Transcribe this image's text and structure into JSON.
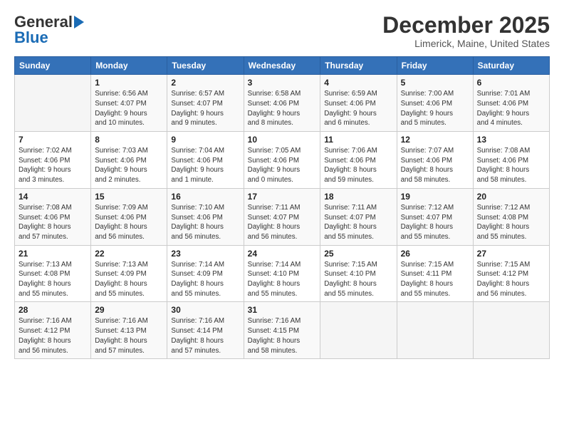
{
  "header": {
    "logo_general": "General",
    "logo_blue": "Blue",
    "month_title": "December 2025",
    "location": "Limerick, Maine, United States"
  },
  "weekdays": [
    "Sunday",
    "Monday",
    "Tuesday",
    "Wednesday",
    "Thursday",
    "Friday",
    "Saturday"
  ],
  "weeks": [
    [
      {
        "day": "",
        "info": ""
      },
      {
        "day": "1",
        "info": "Sunrise: 6:56 AM\nSunset: 4:07 PM\nDaylight: 9 hours\nand 10 minutes."
      },
      {
        "day": "2",
        "info": "Sunrise: 6:57 AM\nSunset: 4:07 PM\nDaylight: 9 hours\nand 9 minutes."
      },
      {
        "day": "3",
        "info": "Sunrise: 6:58 AM\nSunset: 4:06 PM\nDaylight: 9 hours\nand 8 minutes."
      },
      {
        "day": "4",
        "info": "Sunrise: 6:59 AM\nSunset: 4:06 PM\nDaylight: 9 hours\nand 6 minutes."
      },
      {
        "day": "5",
        "info": "Sunrise: 7:00 AM\nSunset: 4:06 PM\nDaylight: 9 hours\nand 5 minutes."
      },
      {
        "day": "6",
        "info": "Sunrise: 7:01 AM\nSunset: 4:06 PM\nDaylight: 9 hours\nand 4 minutes."
      }
    ],
    [
      {
        "day": "7",
        "info": "Sunrise: 7:02 AM\nSunset: 4:06 PM\nDaylight: 9 hours\nand 3 minutes."
      },
      {
        "day": "8",
        "info": "Sunrise: 7:03 AM\nSunset: 4:06 PM\nDaylight: 9 hours\nand 2 minutes."
      },
      {
        "day": "9",
        "info": "Sunrise: 7:04 AM\nSunset: 4:06 PM\nDaylight: 9 hours\nand 1 minute."
      },
      {
        "day": "10",
        "info": "Sunrise: 7:05 AM\nSunset: 4:06 PM\nDaylight: 9 hours\nand 0 minutes."
      },
      {
        "day": "11",
        "info": "Sunrise: 7:06 AM\nSunset: 4:06 PM\nDaylight: 8 hours\nand 59 minutes."
      },
      {
        "day": "12",
        "info": "Sunrise: 7:07 AM\nSunset: 4:06 PM\nDaylight: 8 hours\nand 58 minutes."
      },
      {
        "day": "13",
        "info": "Sunrise: 7:08 AM\nSunset: 4:06 PM\nDaylight: 8 hours\nand 58 minutes."
      }
    ],
    [
      {
        "day": "14",
        "info": "Sunrise: 7:08 AM\nSunset: 4:06 PM\nDaylight: 8 hours\nand 57 minutes."
      },
      {
        "day": "15",
        "info": "Sunrise: 7:09 AM\nSunset: 4:06 PM\nDaylight: 8 hours\nand 56 minutes."
      },
      {
        "day": "16",
        "info": "Sunrise: 7:10 AM\nSunset: 4:06 PM\nDaylight: 8 hours\nand 56 minutes."
      },
      {
        "day": "17",
        "info": "Sunrise: 7:11 AM\nSunset: 4:07 PM\nDaylight: 8 hours\nand 56 minutes."
      },
      {
        "day": "18",
        "info": "Sunrise: 7:11 AM\nSunset: 4:07 PM\nDaylight: 8 hours\nand 55 minutes."
      },
      {
        "day": "19",
        "info": "Sunrise: 7:12 AM\nSunset: 4:07 PM\nDaylight: 8 hours\nand 55 minutes."
      },
      {
        "day": "20",
        "info": "Sunrise: 7:12 AM\nSunset: 4:08 PM\nDaylight: 8 hours\nand 55 minutes."
      }
    ],
    [
      {
        "day": "21",
        "info": "Sunrise: 7:13 AM\nSunset: 4:08 PM\nDaylight: 8 hours\nand 55 minutes."
      },
      {
        "day": "22",
        "info": "Sunrise: 7:13 AM\nSunset: 4:09 PM\nDaylight: 8 hours\nand 55 minutes."
      },
      {
        "day": "23",
        "info": "Sunrise: 7:14 AM\nSunset: 4:09 PM\nDaylight: 8 hours\nand 55 minutes."
      },
      {
        "day": "24",
        "info": "Sunrise: 7:14 AM\nSunset: 4:10 PM\nDaylight: 8 hours\nand 55 minutes."
      },
      {
        "day": "25",
        "info": "Sunrise: 7:15 AM\nSunset: 4:10 PM\nDaylight: 8 hours\nand 55 minutes."
      },
      {
        "day": "26",
        "info": "Sunrise: 7:15 AM\nSunset: 4:11 PM\nDaylight: 8 hours\nand 55 minutes."
      },
      {
        "day": "27",
        "info": "Sunrise: 7:15 AM\nSunset: 4:12 PM\nDaylight: 8 hours\nand 56 minutes."
      }
    ],
    [
      {
        "day": "28",
        "info": "Sunrise: 7:16 AM\nSunset: 4:12 PM\nDaylight: 8 hours\nand 56 minutes."
      },
      {
        "day": "29",
        "info": "Sunrise: 7:16 AM\nSunset: 4:13 PM\nDaylight: 8 hours\nand 57 minutes."
      },
      {
        "day": "30",
        "info": "Sunrise: 7:16 AM\nSunset: 4:14 PM\nDaylight: 8 hours\nand 57 minutes."
      },
      {
        "day": "31",
        "info": "Sunrise: 7:16 AM\nSunset: 4:15 PM\nDaylight: 8 hours\nand 58 minutes."
      },
      {
        "day": "",
        "info": ""
      },
      {
        "day": "",
        "info": ""
      },
      {
        "day": "",
        "info": ""
      }
    ]
  ]
}
